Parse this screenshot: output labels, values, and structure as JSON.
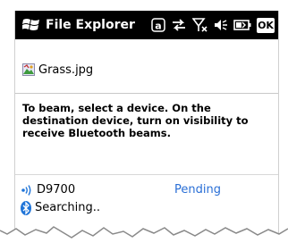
{
  "titlebar": {
    "app_title": "File Explorer",
    "ok_label": "OK",
    "background": "#000000",
    "icons": [
      "windows-flag-icon",
      "keyboard-a-icon",
      "data-transfer-icon",
      "no-signal-icon",
      "speaker-icon",
      "battery-icon"
    ]
  },
  "file": {
    "name": "Grass.jpg",
    "icon": "image-file-icon"
  },
  "message": {
    "text": "To beam, select a device. On the destination device, turn on visibility to receive Bluetooth beams."
  },
  "devices": [
    {
      "name": "D9700",
      "status": "Pending",
      "icon": "beam-device-icon",
      "status_color": "#2a6fd6"
    }
  ],
  "search": {
    "text": "Searching..",
    "icon": "bluetooth-icon",
    "icon_color": "#1f74d8"
  }
}
